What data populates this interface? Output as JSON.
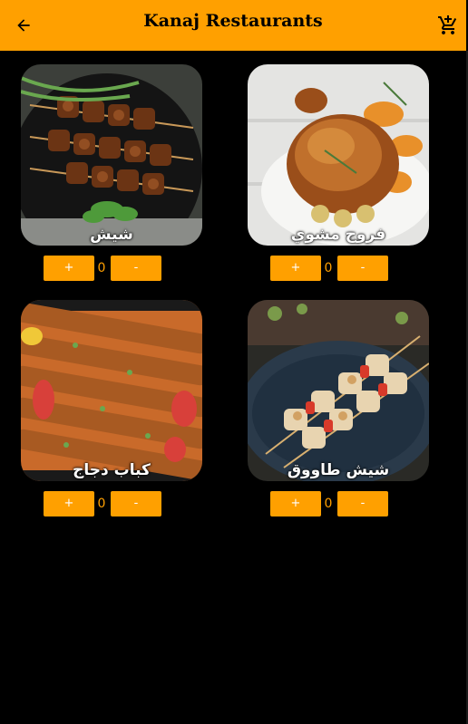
{
  "app": {
    "title": "Kanaj Restaurants",
    "accent": "#ffa000",
    "icons": {
      "back": "arrow-back-icon",
      "cart": "add-shopping-cart-icon"
    }
  },
  "items": [
    {
      "name": "شيش",
      "quantity": "0",
      "plus_label": "+",
      "minus_label": "-"
    },
    {
      "name": "فروج مشوي",
      "quantity": "0",
      "plus_label": "+",
      "minus_label": "-"
    },
    {
      "name": "كباب دجاج",
      "quantity": "0",
      "plus_label": "+",
      "minus_label": "-"
    },
    {
      "name": "شيش طاووق",
      "quantity": "0",
      "plus_label": "+",
      "minus_label": "-"
    }
  ]
}
